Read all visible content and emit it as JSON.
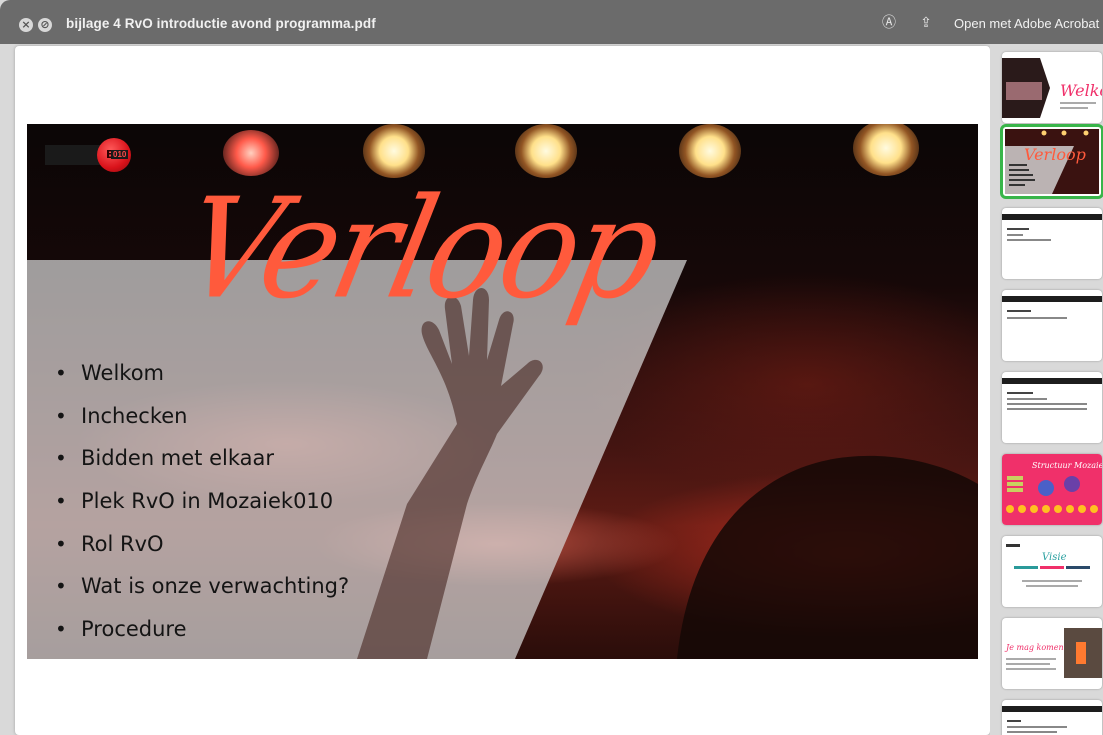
{
  "window": {
    "title": "bijlage 4 RvO introductie avond programma.pdf",
    "open_button": "Open met Adobe Acrobat"
  },
  "icons": {
    "close": "close-icon",
    "stop": "stop-icon",
    "markup": "markup-icon",
    "share": "share-icon"
  },
  "slide": {
    "logo_text": "EK",
    "logo_number": "010",
    "title": "Verloop",
    "bullets": [
      "Welkom",
      "Inchecken",
      "Bidden met elkaar",
      "Plek RvO in Mozaiek010",
      "Rol RvO",
      "Wat is onze verwachting?",
      "Procedure"
    ]
  },
  "thumbnails": {
    "count": 9,
    "selected_index": 1,
    "items": [
      {
        "label": "Welkom"
      },
      {
        "label": "Verloop"
      },
      {
        "label": ""
      },
      {
        "label": ""
      },
      {
        "label": ""
      },
      {
        "label": "Strukturr Mozaiek010"
      },
      {
        "label": "Visie"
      },
      {
        "label": ""
      },
      {
        "label": ""
      }
    ]
  },
  "colors": {
    "titlebar": "#6b6b6b",
    "accent_title": "#ff5a3c",
    "selected_thumb": "#39b54a",
    "thumb_pink": "#f0306a"
  }
}
